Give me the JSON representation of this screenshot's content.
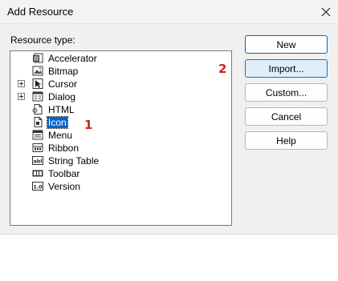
{
  "dialog": {
    "title": "Add Resource",
    "resource_type_label": "Resource type:",
    "close_icon": "close-icon"
  },
  "resource_types": [
    {
      "label": "Accelerator",
      "icon": "accelerator-icon",
      "expandable": false,
      "selected": false
    },
    {
      "label": "Bitmap",
      "icon": "bitmap-icon",
      "expandable": false,
      "selected": false
    },
    {
      "label": "Cursor",
      "icon": "cursor-icon",
      "expandable": true,
      "selected": false
    },
    {
      "label": "Dialog",
      "icon": "dialog-icon",
      "expandable": true,
      "selected": false
    },
    {
      "label": "HTML",
      "icon": "html-icon",
      "expandable": false,
      "selected": false
    },
    {
      "label": "Icon",
      "icon": "icon-resource-icon",
      "expandable": false,
      "selected": true
    },
    {
      "label": "Menu",
      "icon": "menu-icon",
      "expandable": false,
      "selected": false
    },
    {
      "label": "Ribbon",
      "icon": "ribbon-icon",
      "expandable": false,
      "selected": false
    },
    {
      "label": "String Table",
      "icon": "string-table-icon",
      "expandable": false,
      "selected": false
    },
    {
      "label": "Toolbar",
      "icon": "toolbar-icon",
      "expandable": false,
      "selected": false
    },
    {
      "label": "Version",
      "icon": "version-icon",
      "expandable": false,
      "selected": false
    }
  ],
  "icon_glyphs": {
    "string_table": "abl",
    "version": "1.0"
  },
  "buttons": {
    "new": "New",
    "import": "Import...",
    "custom": "Custom...",
    "cancel": "Cancel",
    "help": "Help"
  },
  "annotations": {
    "step1": "1",
    "step2": "2"
  },
  "colors": {
    "selection": "#0a64c8",
    "annotation": "#d11f1f",
    "default_button_border": "#0067c0"
  }
}
